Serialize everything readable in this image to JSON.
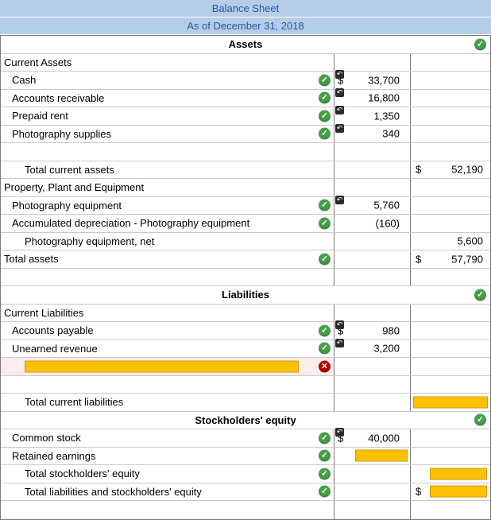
{
  "header": {
    "title": "Balance Sheet",
    "subtitle": "As of December 31, 2018"
  },
  "colors": {
    "header_bg": "#B5CDE8",
    "header_text": "#2458A8",
    "check_green": "#45A049",
    "error_red": "#C00000",
    "input_orange": "#FFC000",
    "error_row_bg": "#FBEDEB",
    "grid_dark": "#7A7A7A",
    "grid_light": "#C9C9C9"
  },
  "icons": {
    "correct_check_icon": "✓",
    "incorrect_x_icon": "✕",
    "prior_answer_arrow_icon": "↶"
  },
  "rows": [
    {
      "type": "section",
      "label": "Assets",
      "check": "green"
    },
    {
      "type": "item",
      "label": "Current Assets",
      "indent": 0
    },
    {
      "type": "item",
      "label": "Cash",
      "indent": 1,
      "check": "green",
      "col1": {
        "arrow": true,
        "dollar": "$",
        "value": "33,700"
      }
    },
    {
      "type": "item",
      "label": "Accounts receivable",
      "indent": 1,
      "check": "green",
      "col1": {
        "arrow": true,
        "value": "16,800"
      }
    },
    {
      "type": "item",
      "label": "Prepaid rent",
      "indent": 1,
      "check": "green",
      "col1": {
        "arrow": true,
        "value": "1,350"
      }
    },
    {
      "type": "item",
      "label": "Photography supplies",
      "indent": 1,
      "check": "green",
      "col1": {
        "arrow": true,
        "value": "340"
      }
    },
    {
      "type": "blank"
    },
    {
      "type": "item",
      "label": "Total current assets",
      "indent": 2,
      "col2": {
        "dollar": "$",
        "value": "52,190"
      }
    },
    {
      "type": "item",
      "label": "Property, Plant and Equipment",
      "indent": 0
    },
    {
      "type": "item",
      "label": "Photography equipment",
      "indent": 1,
      "check": "green",
      "col1": {
        "arrow": true,
        "value": "5,760"
      }
    },
    {
      "type": "item",
      "label": "Accumulated depreciation - Photography equipment",
      "indent": 1,
      "check": "green",
      "col1": {
        "value": "(160)"
      }
    },
    {
      "type": "item",
      "label": "Photography equipment, net",
      "indent": 2,
      "col2": {
        "value": "5,600"
      }
    },
    {
      "type": "item",
      "label": "Total assets",
      "indent": 0,
      "check": "green",
      "col2": {
        "dollar": "$",
        "value": "57,790"
      }
    },
    {
      "type": "blank"
    },
    {
      "type": "section",
      "label": "Liabilities",
      "check": "green"
    },
    {
      "type": "item",
      "label": "Current Liabilities",
      "indent": 0
    },
    {
      "type": "item",
      "label": "Accounts payable",
      "indent": 1,
      "check": "green",
      "col1": {
        "arrow": true,
        "dollar": "$",
        "value": "980"
      }
    },
    {
      "type": "item",
      "label": "Unearned revenue",
      "indent": 1,
      "check": "green",
      "col1": {
        "arrow": true,
        "value": "3,200"
      }
    },
    {
      "type": "item",
      "label": "",
      "indent": 1,
      "check": "red",
      "label_input": true,
      "error_bg": true
    },
    {
      "type": "blank"
    },
    {
      "type": "item",
      "label": "Total current liabilities",
      "indent": 2,
      "col2": {
        "input": "full"
      }
    },
    {
      "type": "section",
      "label": "Stockholders' equity",
      "check": "green"
    },
    {
      "type": "item",
      "label": "Common stock",
      "indent": 1,
      "check": "green",
      "col1": {
        "arrow": true,
        "dollar": "$",
        "value": "40,000"
      }
    },
    {
      "type": "item",
      "label": "Retained earnings",
      "indent": 1,
      "check": "green",
      "col1": {
        "input": "partial"
      }
    },
    {
      "type": "item",
      "label": "Total stockholders' equity",
      "indent": 2,
      "check": "green",
      "col2": {
        "input": "partial"
      }
    },
    {
      "type": "item",
      "label": "Total liabilities and stockholders' equity",
      "indent": 2,
      "check": "green",
      "col2": {
        "dollar": "$",
        "input": "partial"
      }
    },
    {
      "type": "blank"
    }
  ]
}
